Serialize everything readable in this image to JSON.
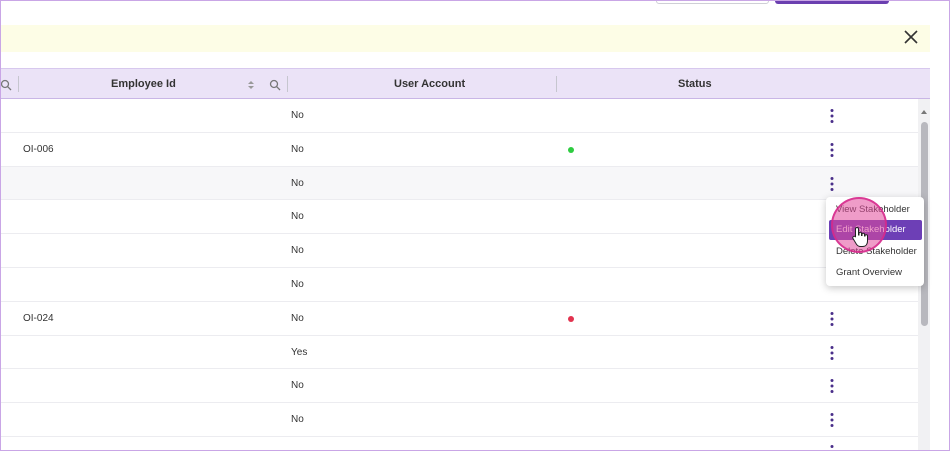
{
  "table": {
    "columns": {
      "employee_id": "Employee Id",
      "user_account": "User Account",
      "status": "Status"
    },
    "rows": [
      {
        "employee_id": "",
        "user_account": "No",
        "status": ""
      },
      {
        "employee_id": "OI-006",
        "user_account": "No",
        "status": "green"
      },
      {
        "employee_id": "",
        "user_account": "No",
        "status": ""
      },
      {
        "employee_id": "",
        "user_account": "No",
        "status": ""
      },
      {
        "employee_id": "",
        "user_account": "No",
        "status": ""
      },
      {
        "employee_id": "",
        "user_account": "No",
        "status": ""
      },
      {
        "employee_id": "OI-024",
        "user_account": "No",
        "status": "red"
      },
      {
        "employee_id": "",
        "user_account": "Yes",
        "status": ""
      },
      {
        "employee_id": "",
        "user_account": "No",
        "status": ""
      },
      {
        "employee_id": "",
        "user_account": "No",
        "status": ""
      }
    ]
  },
  "context_menu": {
    "items": [
      "View Stakeholder",
      "Edit Stakeholder",
      "Delete Stakeholder",
      "Grant Overview"
    ],
    "active_index": 1
  },
  "icons": {
    "banner_close": "close-icon",
    "header_search": "search-icon",
    "sort": "sort-icon",
    "row_actions": "kebab-menu-icon",
    "cursor": "hand-pointer-icon"
  },
  "colors": {
    "accent": "#6d3fb6",
    "header_bg": "#ebe3f7",
    "banner_bg": "#fdfde6",
    "status_green": "#2ecc40",
    "status_red": "#e2334f",
    "click_indicator": "#e24b9b"
  }
}
